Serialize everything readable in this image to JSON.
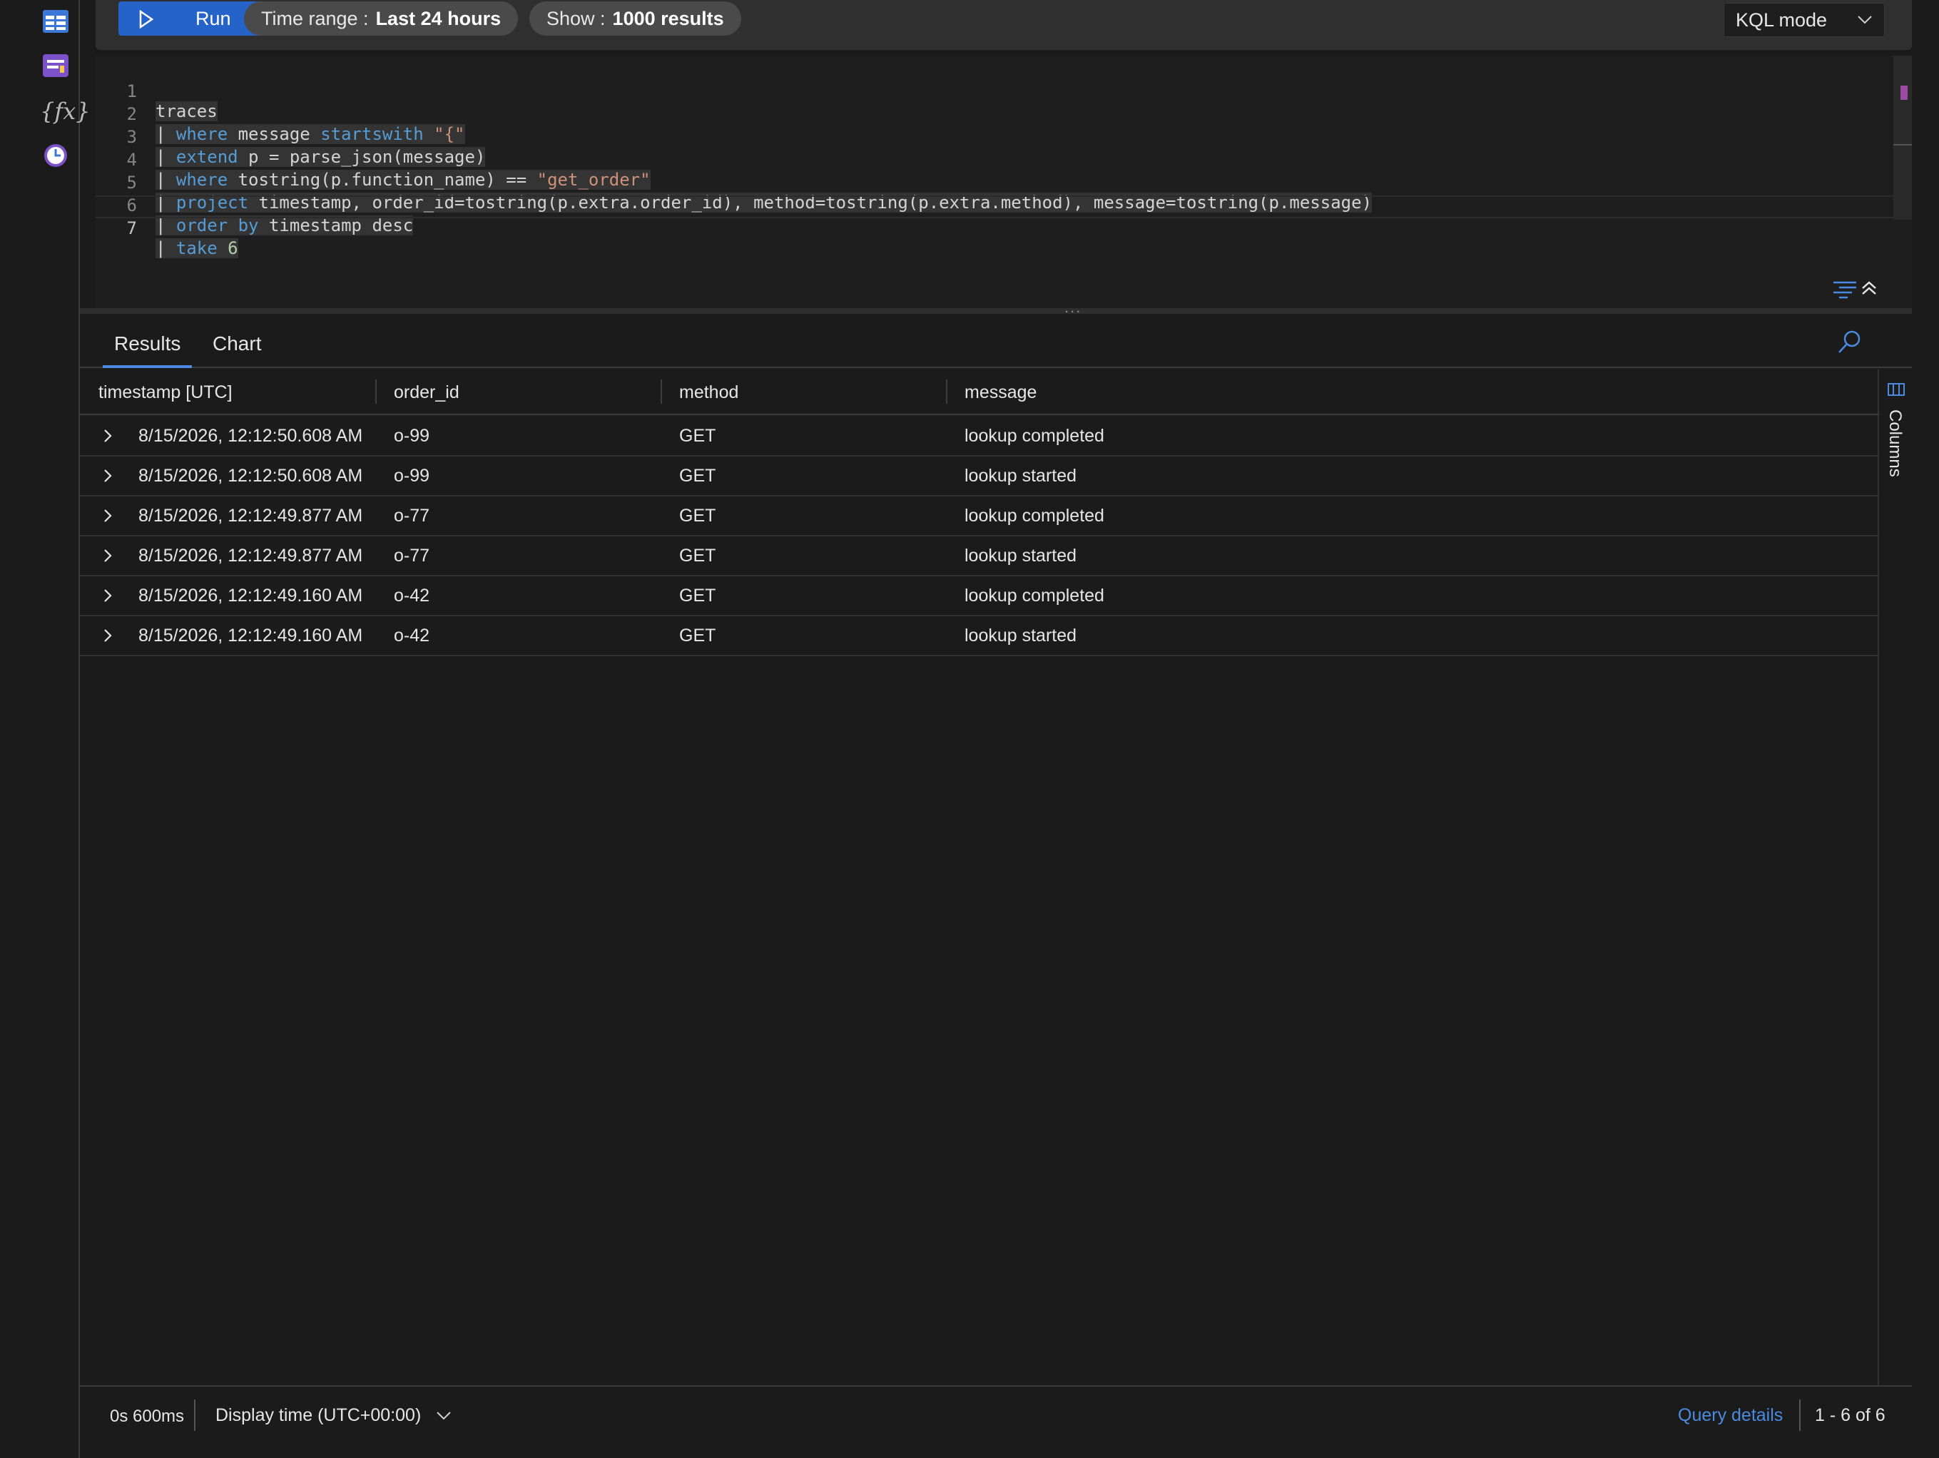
{
  "toolbar": {
    "run_label": "Run",
    "time_range_key": "Time range :",
    "time_range_value": "Last 24 hours",
    "show_key": "Show :",
    "show_value": "1000 results",
    "mode": "KQL mode"
  },
  "editor": {
    "line_numbers": [
      "1",
      "2",
      "3",
      "4",
      "5",
      "6",
      "7"
    ],
    "lines": [
      "traces",
      "| where message startswith \"{\"",
      "| extend p = parse_json(message)",
      "| where tostring(p.function_name) == \"get_order\"",
      "| project timestamp, order_id=tostring(p.extra.order_id), method=tostring(p.extra.method), message=tostring(p.message)",
      "| order by timestamp desc",
      "| take 6"
    ],
    "splitter": "..."
  },
  "results": {
    "tabs": [
      "Results",
      "Chart"
    ],
    "columns": [
      "timestamp [UTC]",
      "order_id",
      "method",
      "message"
    ],
    "rows": [
      [
        "8/15/2026, 12:12:50.608 AM",
        "o-99",
        "GET",
        "lookup completed"
      ],
      [
        "8/15/2026, 12:12:50.608 AM",
        "o-99",
        "GET",
        "lookup started"
      ],
      [
        "8/15/2026, 12:12:49.877 AM",
        "o-77",
        "GET",
        "lookup completed"
      ],
      [
        "8/15/2026, 12:12:49.877 AM",
        "o-77",
        "GET",
        "lookup started"
      ],
      [
        "8/15/2026, 12:12:49.160 AM",
        "o-42",
        "GET",
        "lookup completed"
      ],
      [
        "8/15/2026, 12:12:49.160 AM",
        "o-42",
        "GET",
        "lookup started"
      ]
    ],
    "columns_panel_label": "Columns"
  },
  "footer": {
    "duration": "0s 600ms",
    "display_time": "Display time (UTC+00:00)",
    "query_details": "Query details",
    "count": "1 - 6 of 6"
  },
  "colors": {
    "accent": "#2563c9",
    "link": "#4a8ae0",
    "keyword": "#569cd6",
    "string": "#ce9178",
    "number": "#b5cea8"
  },
  "icons": {
    "rail": [
      "tables-icon",
      "queries-icon",
      "functions-icon",
      "history-icon"
    ],
    "run": "play-icon",
    "mode": "chevron-down-icon",
    "results_search": "search-icon",
    "row_expand": "chevron-right-icon",
    "columns": "columns-icon",
    "display_time": "chevron-down-icon"
  }
}
